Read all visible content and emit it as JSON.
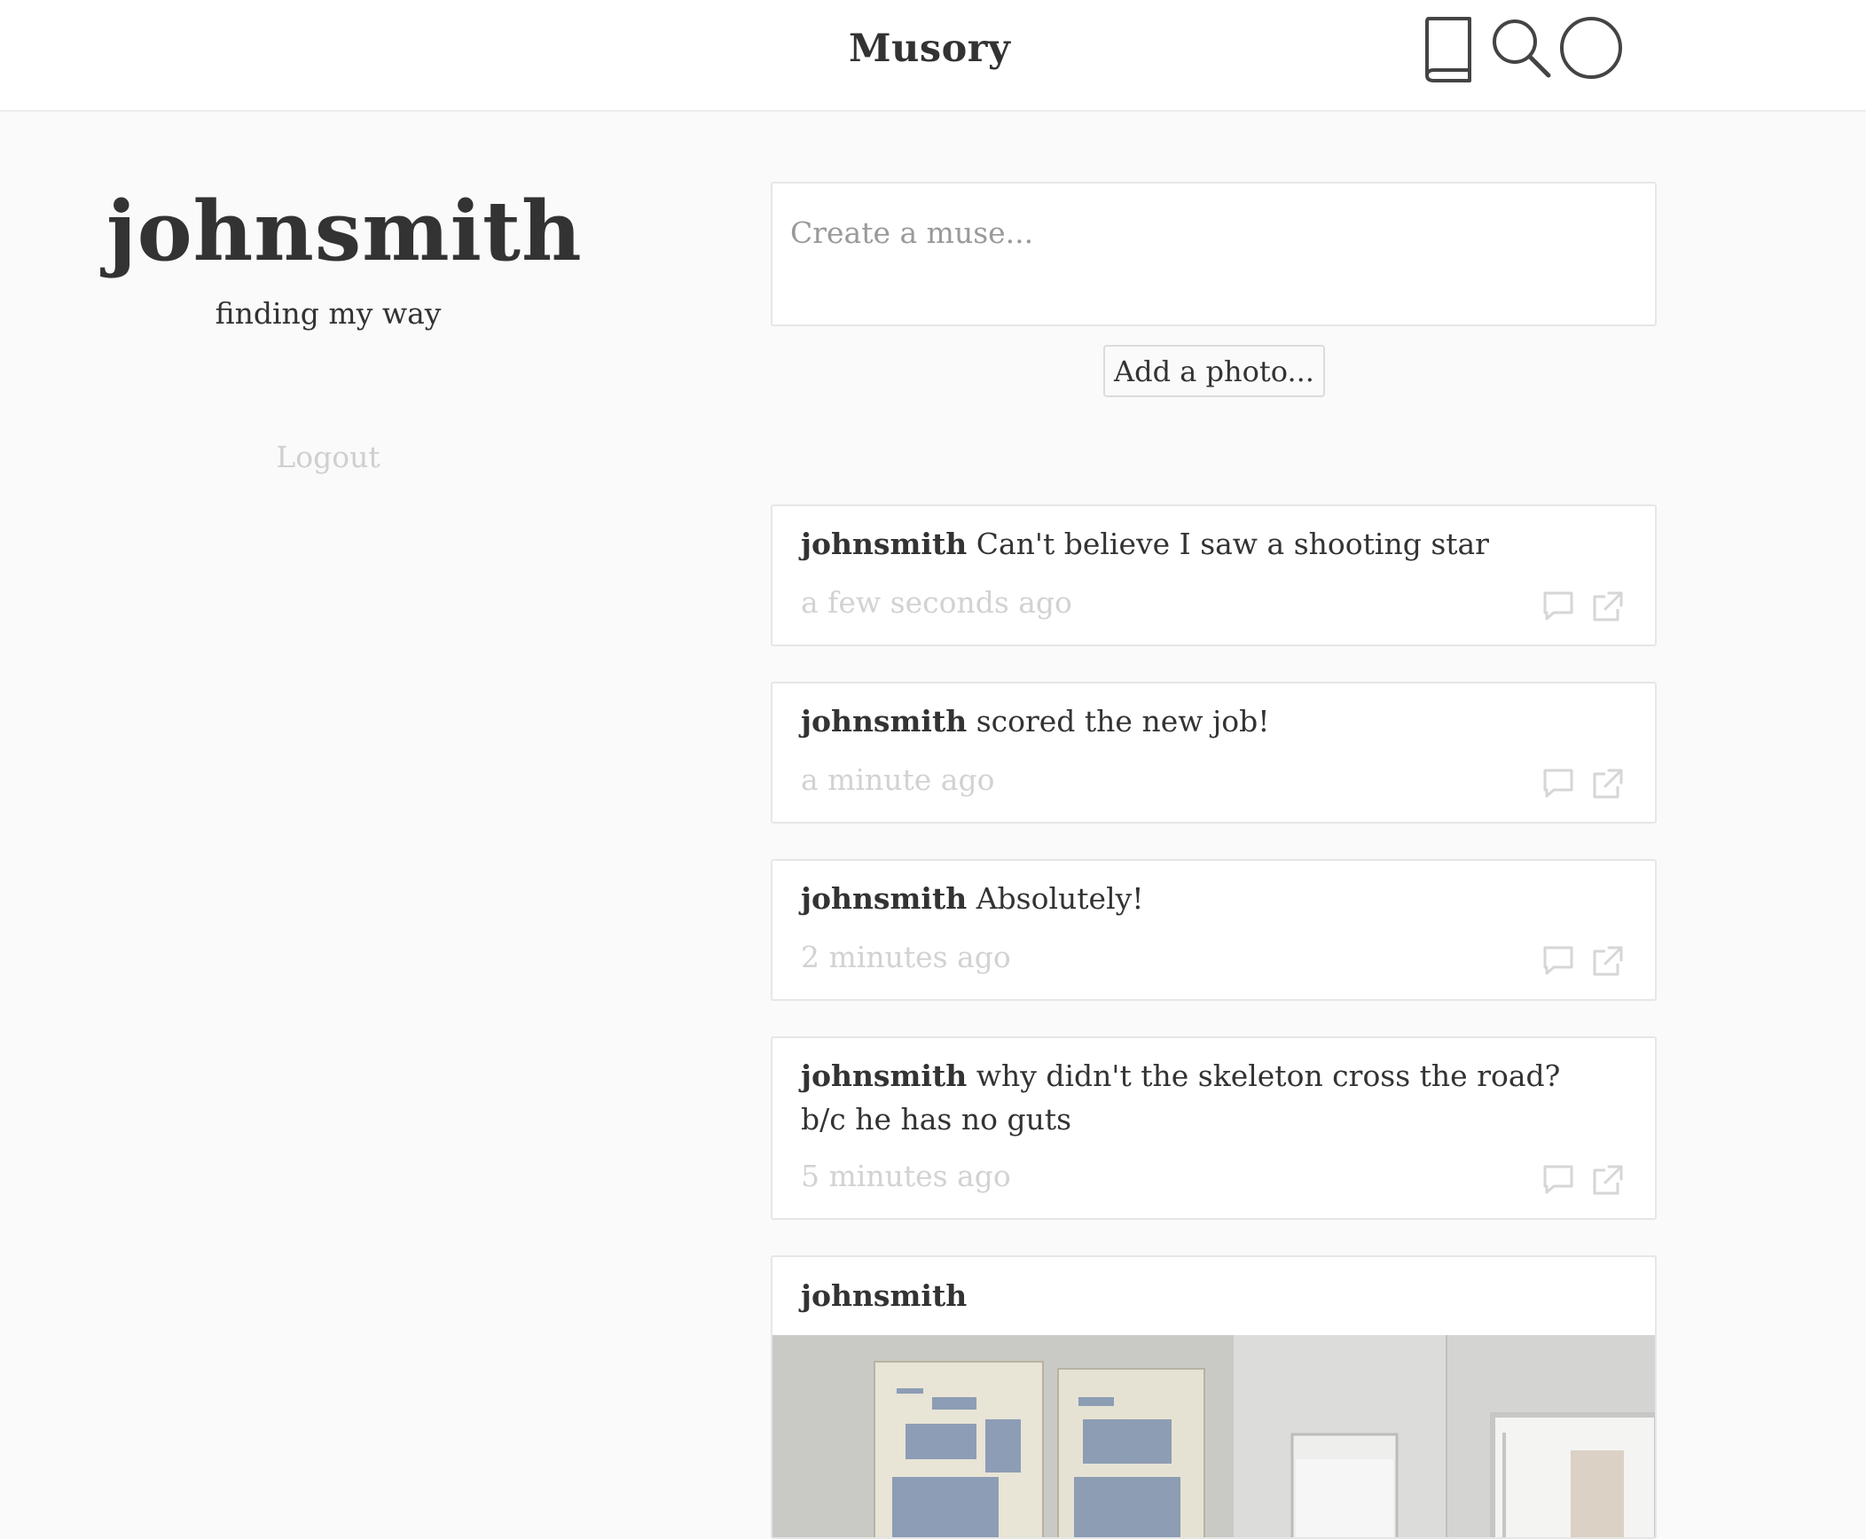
{
  "header": {
    "brand": "Musory",
    "icons": [
      "book-icon",
      "search-icon",
      "profile-circle-icon"
    ]
  },
  "profile": {
    "username": "johnsmith",
    "tagline": "finding my way",
    "logout_label": "Logout"
  },
  "composer": {
    "placeholder": "Create a muse...",
    "value": "",
    "add_photo_label": "Add a photo..."
  },
  "feed": {
    "posts": [
      {
        "author": "johnsmith",
        "text": "Can't believe I saw a shooting star",
        "time": "a few seconds ago"
      },
      {
        "author": "johnsmith",
        "text": "scored the new job!",
        "time": "a minute ago"
      },
      {
        "author": "johnsmith",
        "text": "Absolutely!",
        "time": "2 minutes ago"
      },
      {
        "author": "johnsmith",
        "text": "why didn't the skeleton cross the road? b/c he has no guts",
        "time": "5 minutes ago"
      }
    ],
    "photo_post": {
      "author": "johnsmith"
    },
    "post_action_icons": [
      "comment-icon",
      "external-link-icon"
    ]
  },
  "colors": {
    "page_background": "#fafafa",
    "card_border": "#e6e6e6",
    "text": "#333333",
    "muted_text": "#d2d2d2",
    "placeholder_text": "#9a9a9a"
  }
}
